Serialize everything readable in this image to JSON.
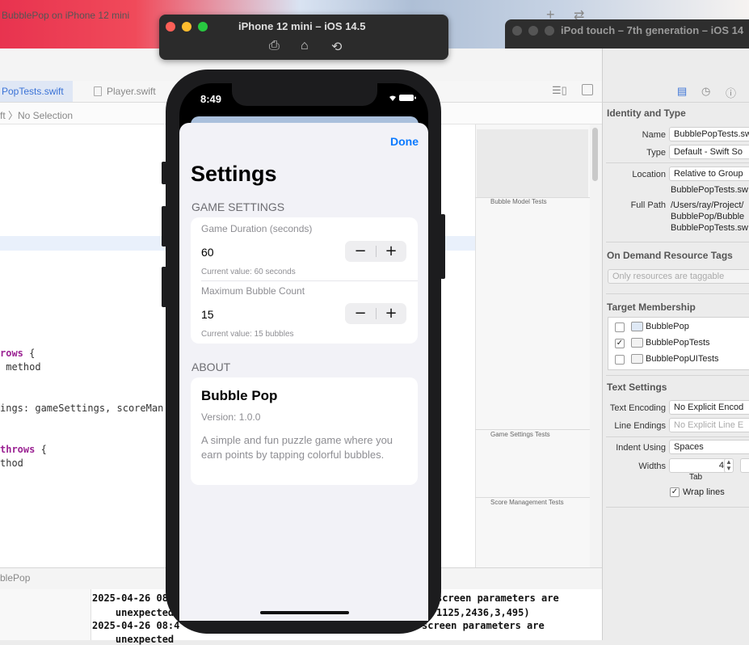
{
  "xcode": {
    "scheme_title": "BubblePop on iPhone 12 mini",
    "tabs": [
      {
        "label": "PopTests.swift"
      },
      {
        "label": "Player.swift"
      }
    ],
    "jumpbar": "ft 〉No Selection",
    "code_lines": [
      {
        "text": "rows {",
        "kw": "rows",
        "rest": " {"
      },
      {
        "text": " method"
      },
      {
        "text": "ings: gameSettings, scoreMan"
      },
      {
        "text": "throws {",
        "kw": "throws",
        "rest": " {"
      },
      {
        "text": "thod"
      }
    ],
    "minimap_labels": [
      "Bubble Model Tests",
      "Game Settings Tests",
      "Score Management Tests"
    ],
    "debug_label": "blePop",
    "console_lines": [
      "2025-04-26 08",
      "    unexpected",
      "2025-04-26 08:4",
      "    unexpected",
      "screen parameters are",
      "1125,2436,3,495)",
      "screen parameters are"
    ]
  },
  "inspector": {
    "identity_header": "Identity and Type",
    "name_label": "Name",
    "name_value": "BubblePopTests.sw",
    "type_label": "Type",
    "type_value": "Default - Swift So",
    "location_label": "Location",
    "location_value": "Relative to Group",
    "location_file": "BubblePopTests.sw",
    "fullpath_label": "Full Path",
    "fullpath_lines": [
      "/Users/ray/Project/",
      "BubblePop/Bubble",
      "BubblePopTests.sw"
    ],
    "tags_header": "On Demand Resource Tags",
    "tags_placeholder": "Only resources are taggable",
    "target_header": "Target Membership",
    "targets": [
      {
        "name": "BubblePop",
        "checked": ""
      },
      {
        "name": "BubblePopTests",
        "checked": "✓"
      },
      {
        "name": "BubblePopUITests",
        "checked": ""
      }
    ],
    "text_header": "Text Settings",
    "encoding_label": "Text Encoding",
    "encoding_value": "No Explicit Encod",
    "endings_label": "Line Endings",
    "endings_value": "No Explicit Line E",
    "indent_label": "Indent Using",
    "indent_value": "Spaces",
    "widths_label": "Widths",
    "widths_value": "4",
    "tab_label": "Tab",
    "wrap_label": "Wrap lines",
    "wrap_checked": "✓"
  },
  "simulator": {
    "title": "iPhone 12 mini – iOS 14.5",
    "second_title": "iPod touch – 7th generation – iOS 14"
  },
  "phone": {
    "time": "8:49",
    "done_label": "Done",
    "title": "Settings",
    "game_section": "GAME SETTINGS",
    "duration_label": "Game Duration (seconds)",
    "duration_value": "60",
    "duration_sub": "Current value: 60 seconds",
    "bubble_label": "Maximum Bubble Count",
    "bubble_value": "15",
    "bubble_sub": "Current value: 15 bubbles",
    "minus": "−",
    "plus": "+",
    "about_section": "ABOUT",
    "app_name": "Bubble Pop",
    "version": "Version: 1.0.0",
    "description": "A simple and fun puzzle game where you earn points by tapping colorful bubbles."
  }
}
